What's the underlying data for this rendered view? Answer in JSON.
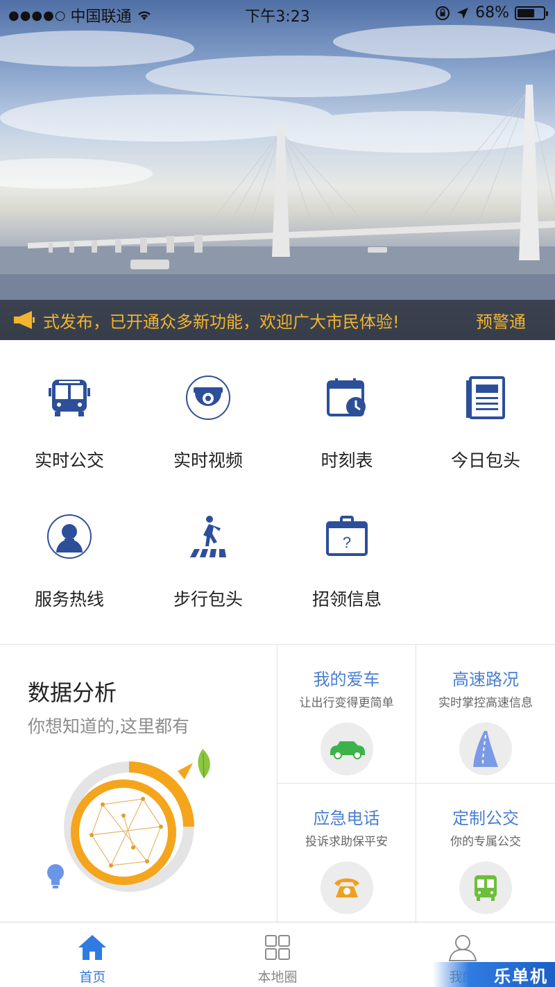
{
  "status_bar": {
    "signal": "●●●●○",
    "carrier": "中国联通",
    "time": "下午3:23",
    "battery_percent": "68%",
    "battery_level": 0.68
  },
  "notice": {
    "text": "式发布，已开通众多新功能，欢迎广大市民体验!",
    "brand": "预警通"
  },
  "grid": {
    "items": [
      {
        "label": "实时公交",
        "icon": "bus-icon"
      },
      {
        "label": "实时视频",
        "icon": "camera-icon"
      },
      {
        "label": "时刻表",
        "icon": "calendar-clock-icon"
      },
      {
        "label": "今日包头",
        "icon": "newspaper-icon"
      },
      {
        "label": "服务热线",
        "icon": "user-service-icon"
      },
      {
        "label": "步行包头",
        "icon": "pedestrian-icon"
      },
      {
        "label": "招领信息",
        "icon": "lost-found-icon"
      }
    ]
  },
  "data_card": {
    "title": "数据分析",
    "subtitle": "你想知道的,这里都有"
  },
  "features": [
    {
      "title": "我的爱车",
      "subtitle": "让出行变得更简单",
      "icon": "car-icon",
      "color": "#3db24a"
    },
    {
      "title": "高速路况",
      "subtitle": "实时掌控高速信息",
      "icon": "highway-icon",
      "color": "#6b8fe0"
    },
    {
      "title": "应急电话",
      "subtitle": "投诉求助保平安",
      "icon": "phone-icon",
      "color": "#f0a020"
    },
    {
      "title": "定制公交",
      "subtitle": "你的专属公交",
      "icon": "bus-icon",
      "color": "#6cbf3a"
    }
  ],
  "tabbar": {
    "tabs": [
      {
        "label": "首页",
        "icon": "home-icon",
        "active": true
      },
      {
        "label": "本地圈",
        "icon": "grid-icon",
        "active": false
      },
      {
        "label": "我的",
        "icon": "profile-icon",
        "active": false
      }
    ]
  },
  "watermark": "乐单机",
  "colors": {
    "accent": "#2f7be0",
    "icon_blue": "#2d4f9a",
    "notice_text": "#f2b430",
    "feature_title": "#4a7fd0"
  }
}
